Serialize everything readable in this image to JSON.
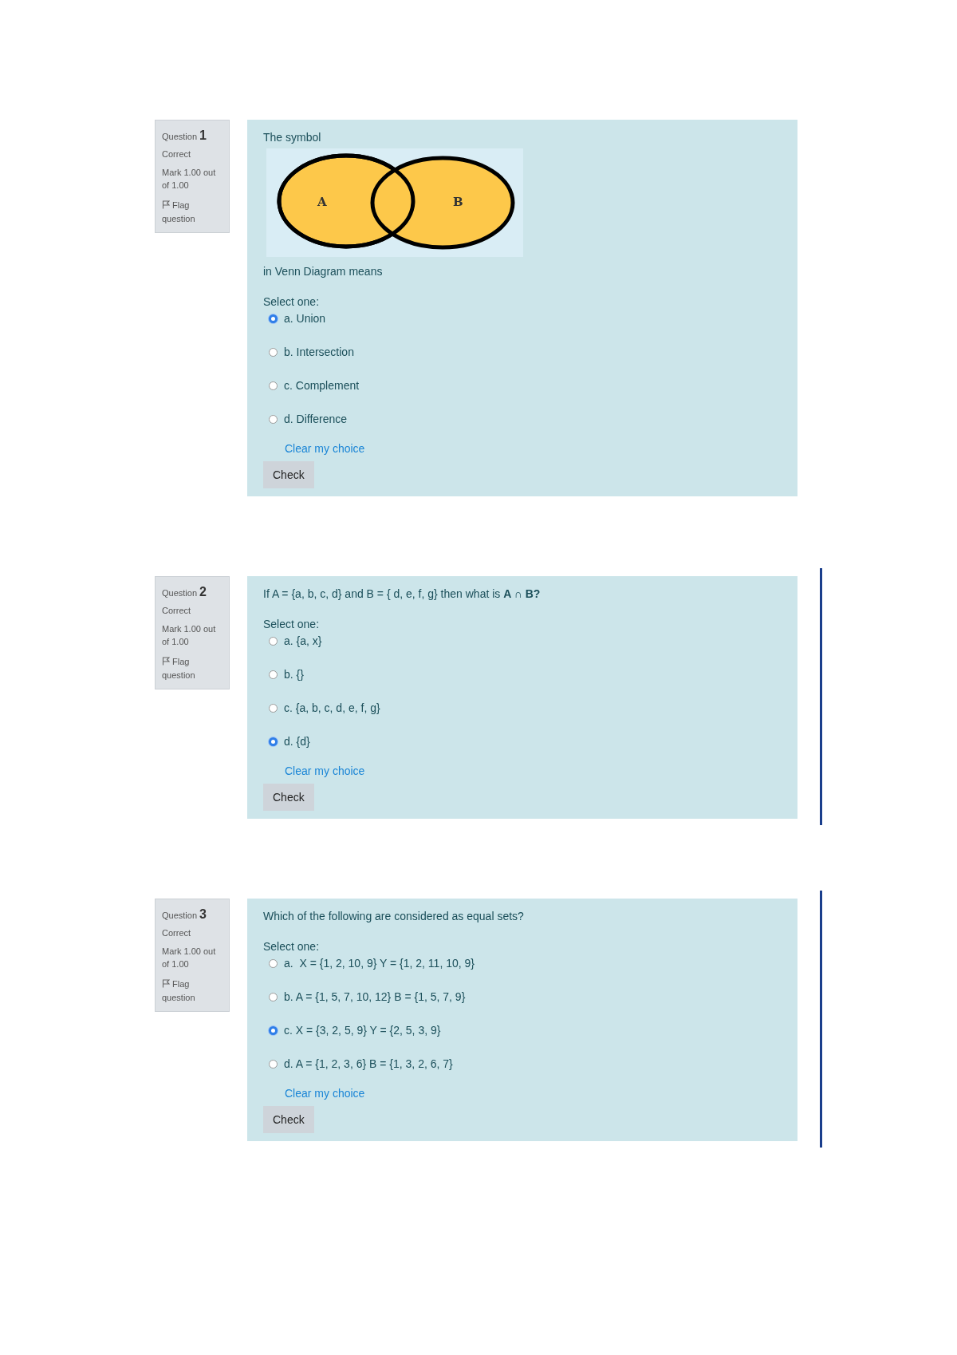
{
  "questions": [
    {
      "label": "Question",
      "number": "1",
      "state": "Correct",
      "mark": "Mark 1.00 out of 1.00",
      "flag": "Flag question",
      "side_bar": false,
      "parts": [
        {
          "kind": "text",
          "text": "The symbol"
        },
        {
          "kind": "venn",
          "labels": [
            "A",
            "B"
          ]
        },
        {
          "kind": "text",
          "text": "in Venn Diagram means"
        }
      ],
      "prompt": "Select one:",
      "options": [
        {
          "label": "a. Union",
          "selected": true
        },
        {
          "label": "b. Intersection",
          "selected": false
        },
        {
          "label": "c. Complement",
          "selected": false
        },
        {
          "label": "d. Difference",
          "selected": false
        }
      ],
      "clear": "Clear my choice",
      "button": "Check"
    },
    {
      "label": "Question",
      "number": "2",
      "state": "Correct",
      "mark": "Mark 1.00 out of 1.00",
      "flag": "Flag question",
      "side_bar": true,
      "parts": [
        {
          "kind": "text",
          "text": "If A = {a, b, c, d} and B = { d, e, f, g} then what is **A ∩ B?**"
        }
      ],
      "prompt": "Select one:",
      "options": [
        {
          "label": "a. {a, x}",
          "selected": false
        },
        {
          "label": "b. {}",
          "selected": false
        },
        {
          "label": "c. {a, b, c, d, e, f, g}",
          "selected": false
        },
        {
          "label": "d. {d}",
          "selected": true
        }
      ],
      "clear": "Clear my choice",
      "button": "Check"
    },
    {
      "label": "Question",
      "number": "3",
      "state": "Correct",
      "mark": "Mark 1.00 out of 1.00",
      "flag": "Flag question",
      "side_bar": true,
      "parts": [
        {
          "kind": "text",
          "text": "Which of the following are considered as equal sets?"
        }
      ],
      "prompt": "Select one:",
      "options": [
        {
          "label": "a.  X = {1, 2, 10, 9} Y = {1, 2, 11, 10, 9}",
          "selected": false
        },
        {
          "label": "b. A = {1, 5, 7, 10, 12} B = {1, 5, 7, 9}",
          "selected": false
        },
        {
          "label": "c. X = {3, 2, 5, 9} Y = {2, 5, 3, 9}",
          "selected": true
        },
        {
          "label": "d. A = {1, 2, 3, 6} B = {1, 3, 2, 6, 7}",
          "selected": false
        }
      ],
      "clear": "Clear my choice",
      "button": "Check"
    }
  ]
}
